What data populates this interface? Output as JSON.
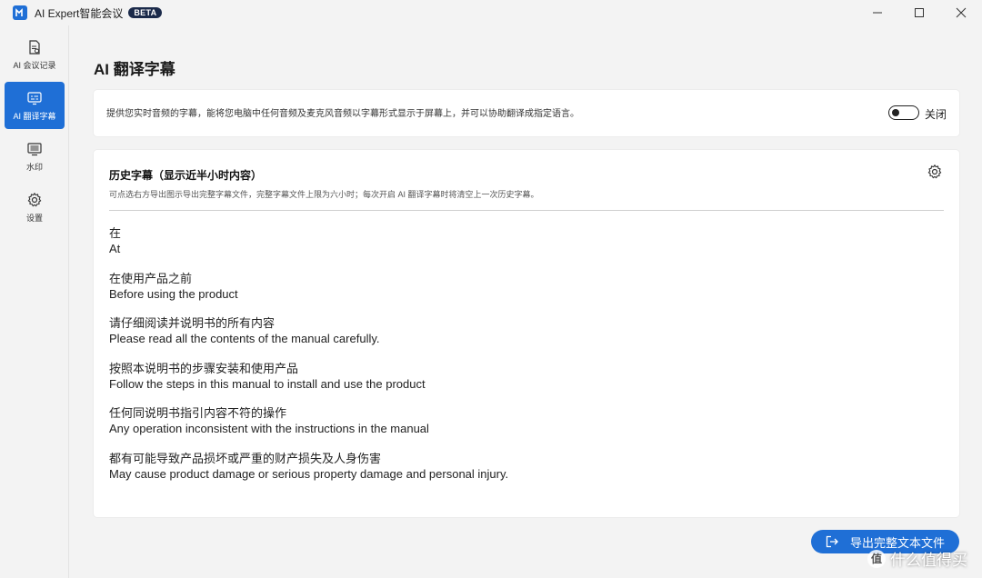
{
  "app": {
    "title": "AI Expert智能会议",
    "badge": "BETA"
  },
  "sidebar": {
    "items": [
      {
        "label": "AI 会议记录",
        "icon": "meeting-notes-icon",
        "active": false
      },
      {
        "label": "AI 翻译字幕",
        "icon": "translate-subtitle-icon",
        "active": true
      },
      {
        "label": "水印",
        "icon": "watermark-icon",
        "active": false
      },
      {
        "label": "设置",
        "icon": "gear-icon",
        "active": false
      }
    ]
  },
  "page": {
    "title": "AI 翻译字幕",
    "description": "提供您实时音频的字幕，能将您电脑中任何音频及麦克风音频以字幕形式显示于屏幕上，并可以协助翻译成指定语言。",
    "toggle": {
      "state": "off",
      "label": "关闭"
    }
  },
  "history": {
    "title": "历史字幕（显示近半小时内容）",
    "subtitle": "可点选右方导出图示导出完整字幕文件，完整字幕文件上限为六小时；每次开启 AI 翻译字幕时将清空上一次历史字幕。",
    "entries": [
      {
        "zh": "在",
        "en": "At"
      },
      {
        "zh": "在使用产品之前",
        "en": "Before using the product"
      },
      {
        "zh": "请仔细阅读并说明书的所有内容",
        "en": "Please read all the contents of the manual carefully."
      },
      {
        "zh": "按照本说明书的步骤安装和使用产品",
        "en": "Follow the steps in this manual to install and use the product"
      },
      {
        "zh": "任何同说明书指引内容不符的操作",
        "en": "Any operation inconsistent with the instructions in the manual"
      },
      {
        "zh": "都有可能导致产品损坏或严重的财产损失及人身伤害",
        "en": "May cause product damage or serious property damage and personal injury."
      }
    ]
  },
  "export": {
    "label": "导出完整文本文件"
  },
  "watermark_overlay": {
    "badge": "值",
    "text": "什么值得买"
  },
  "colors": {
    "accent": "#1f6fd6",
    "background": "#f3f3f3",
    "card": "#ffffff"
  }
}
